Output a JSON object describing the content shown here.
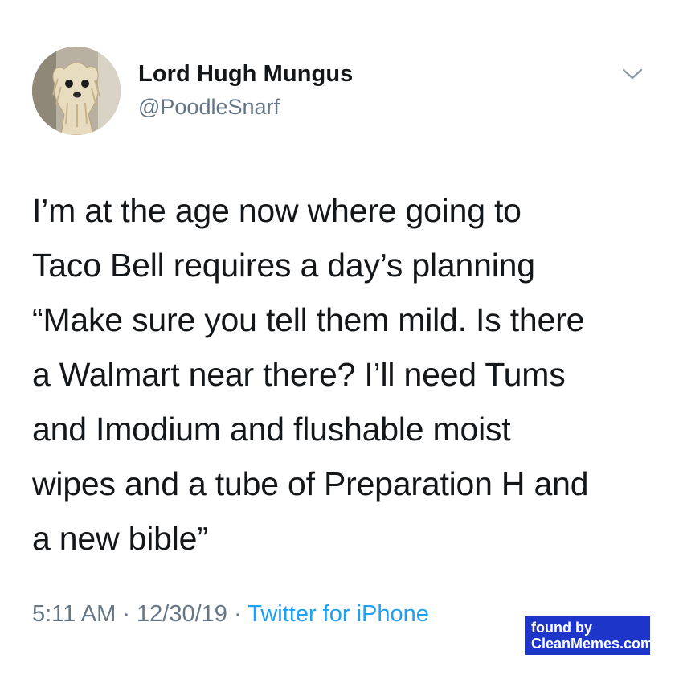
{
  "tweet": {
    "author": {
      "display_name": "Lord Hugh Mungus",
      "handle": "@PoodleSnarf",
      "avatar_icon": "wet-dog-avatar"
    },
    "menu_icon": "chevron-down-icon",
    "text": "I’m at the age now where going to\nTaco Bell requires a day’s planning\n“Make sure you tell them mild. Is there\na Walmart near there? I’ll need Tums\nand Imodium and flushable moist\nwipes and a tube of Preparation H and\na new bible”",
    "time": "5:11 AM",
    "separator": "·",
    "date": "12/30/19",
    "source": "Twitter for iPhone"
  },
  "watermark": {
    "line1": "found by",
    "line2": "CleanMemes.com"
  },
  "colors": {
    "text": "#14171a",
    "secondary": "#657786",
    "link": "#1da1f2",
    "watermark_bg": "#1d36c9"
  }
}
